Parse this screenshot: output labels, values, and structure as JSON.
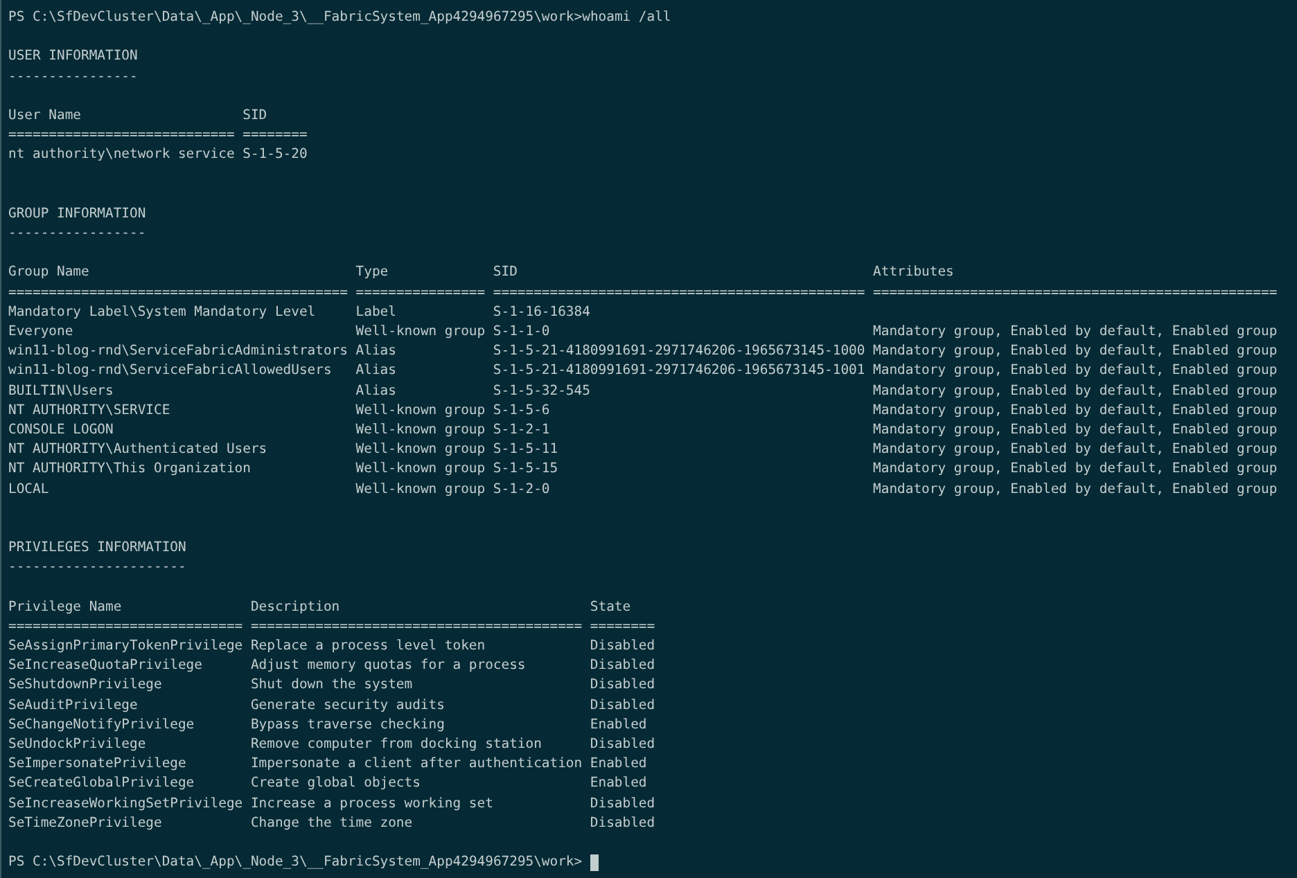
{
  "prompt": "PS C:\\SfDevCluster\\Data\\_App\\_Node_3\\__FabricSystem_App4294967295\\work>",
  "command": "whoami /all",
  "sections": [
    {
      "title": "USER INFORMATION",
      "underline": "----------------",
      "columns": [
        {
          "header": "User Name",
          "rule": "============================"
        },
        {
          "header": "SID",
          "rule": "========"
        }
      ],
      "rows": [
        [
          "nt authority\\network service",
          "S-1-5-20"
        ]
      ]
    },
    {
      "title": "GROUP INFORMATION",
      "underline": "-----------------",
      "columns": [
        {
          "header": "Group Name",
          "rule": "=========================================="
        },
        {
          "header": "Type",
          "rule": "================"
        },
        {
          "header": "SID",
          "rule": "=============================================="
        },
        {
          "header": "Attributes",
          "rule": "=================================================="
        }
      ],
      "rows": [
        [
          "Mandatory Label\\System Mandatory Level",
          "Label",
          "S-1-16-16384"
        ],
        [
          "Everyone",
          "Well-known group",
          "S-1-1-0",
          "Mandatory group, Enabled by default, Enabled group"
        ],
        [
          "win11-blog-rnd\\ServiceFabricAdministrators",
          "Alias",
          "S-1-5-21-4180991691-2971746206-1965673145-1000",
          "Mandatory group, Enabled by default, Enabled group"
        ],
        [
          "win11-blog-rnd\\ServiceFabricAllowedUsers",
          "Alias",
          "S-1-5-21-4180991691-2971746206-1965673145-1001",
          "Mandatory group, Enabled by default, Enabled group"
        ],
        [
          "BUILTIN\\Users",
          "Alias",
          "S-1-5-32-545",
          "Mandatory group, Enabled by default, Enabled group"
        ],
        [
          "NT AUTHORITY\\SERVICE",
          "Well-known group",
          "S-1-5-6",
          "Mandatory group, Enabled by default, Enabled group"
        ],
        [
          "CONSOLE LOGON",
          "Well-known group",
          "S-1-2-1",
          "Mandatory group, Enabled by default, Enabled group"
        ],
        [
          "NT AUTHORITY\\Authenticated Users",
          "Well-known group",
          "S-1-5-11",
          "Mandatory group, Enabled by default, Enabled group"
        ],
        [
          "NT AUTHORITY\\This Organization",
          "Well-known group",
          "S-1-5-15",
          "Mandatory group, Enabled by default, Enabled group"
        ],
        [
          "LOCAL",
          "Well-known group",
          "S-1-2-0",
          "Mandatory group, Enabled by default, Enabled group"
        ]
      ]
    },
    {
      "title": "PRIVILEGES INFORMATION",
      "underline": "----------------------",
      "columns": [
        {
          "header": "Privilege Name",
          "rule": "============================="
        },
        {
          "header": "Description",
          "rule": "========================================="
        },
        {
          "header": "State",
          "rule": "========"
        }
      ],
      "rows": [
        [
          "SeAssignPrimaryTokenPrivilege",
          "Replace a process level token",
          "Disabled"
        ],
        [
          "SeIncreaseQuotaPrivilege",
          "Adjust memory quotas for a process",
          "Disabled"
        ],
        [
          "SeShutdownPrivilege",
          "Shut down the system",
          "Disabled"
        ],
        [
          "SeAuditPrivilege",
          "Generate security audits",
          "Disabled"
        ],
        [
          "SeChangeNotifyPrivilege",
          "Bypass traverse checking",
          "Enabled"
        ],
        [
          "SeUndockPrivilege",
          "Remove computer from docking station",
          "Disabled"
        ],
        [
          "SeImpersonatePrivilege",
          "Impersonate a client after authentication",
          "Enabled"
        ],
        [
          "SeCreateGlobalPrivilege",
          "Create global objects",
          "Enabled"
        ],
        [
          "SeIncreaseWorkingSetPrivilege",
          "Increase a process working set",
          "Disabled"
        ],
        [
          "SeTimeZonePrivilege",
          "Change the time zone",
          "Disabled"
        ]
      ]
    }
  ],
  "final_prompt": "PS C:\\SfDevCluster\\Data\\_App\\_Node_3\\__FabricSystem_App4294967295\\work>"
}
